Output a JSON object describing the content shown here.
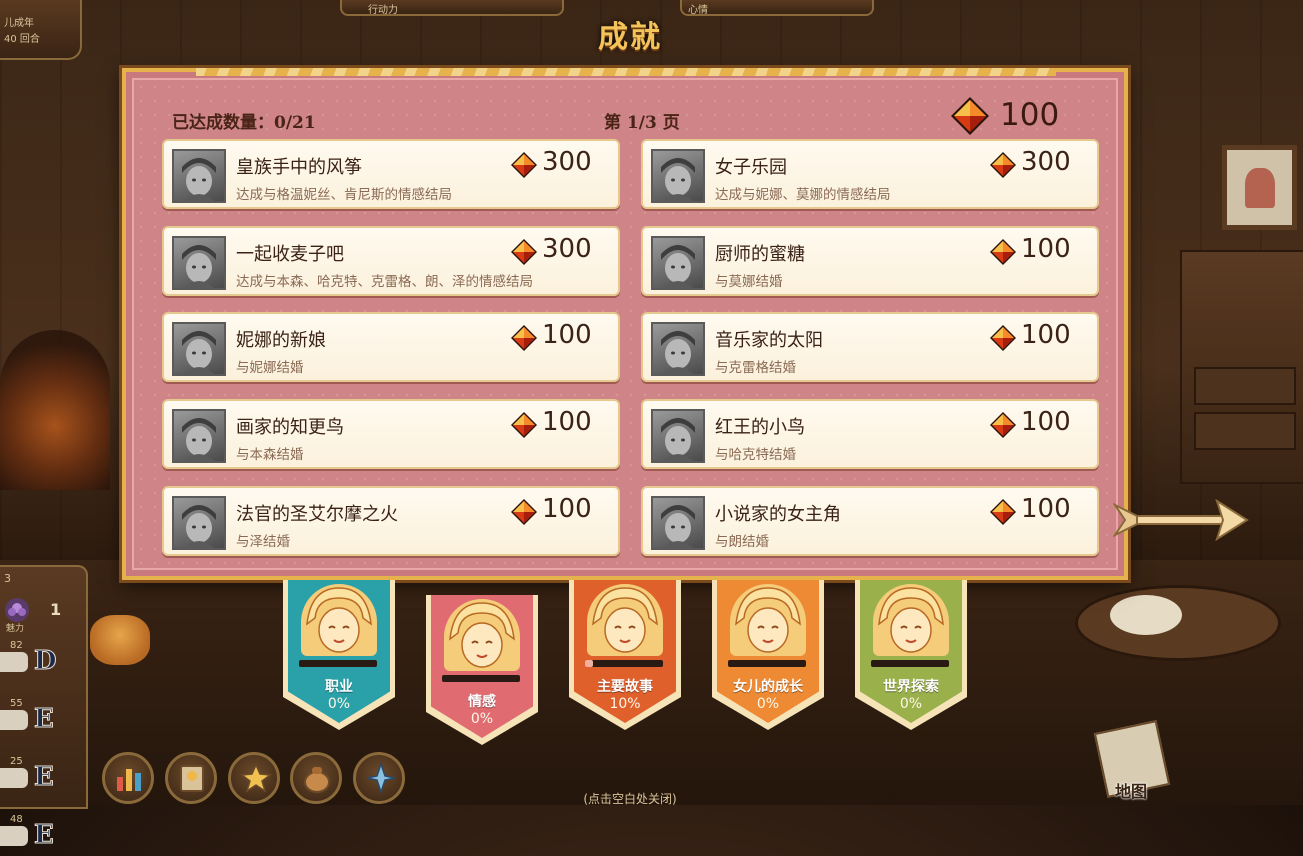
{
  "hud": {
    "left_line1": "儿成年",
    "left_line2": "40 回合",
    "action_label": "行动力",
    "mood_label": "心情"
  },
  "title": "成就",
  "header": {
    "achieved_label": "已达成数量：0/21",
    "page_label": "第 1/3 页",
    "points": "100"
  },
  "achievements": [
    {
      "name": "皇族手中的风筝",
      "desc": "达成与格温妮丝、肯尼斯的情感结局",
      "reward": "300"
    },
    {
      "name": "女子乐园",
      "desc": "达成与妮娜、莫娜的情感结局",
      "reward": "300"
    },
    {
      "name": "一起收麦子吧",
      "desc": "达成与本森、哈克特、克雷格、朗、泽的情感结局",
      "reward": "300"
    },
    {
      "name": "厨师的蜜糖",
      "desc": "与莫娜结婚",
      "reward": "100"
    },
    {
      "name": "妮娜的新娘",
      "desc": "与妮娜结婚",
      "reward": "100"
    },
    {
      "name": "音乐家的太阳",
      "desc": "与克雷格结婚",
      "reward": "100"
    },
    {
      "name": "画家的知更鸟",
      "desc": "与本森结婚",
      "reward": "100"
    },
    {
      "name": "红王的小鸟",
      "desc": "与哈克特结婚",
      "reward": "100"
    },
    {
      "name": "法官的圣艾尔摩之火",
      "desc": "与泽结婚",
      "reward": "100"
    },
    {
      "name": "小说家的女主角",
      "desc": "与朗结婚",
      "reward": "100"
    }
  ],
  "categories": [
    {
      "label": "职业",
      "pct": "0%",
      "progress": 0,
      "color": "#2aa0a8"
    },
    {
      "label": "情感",
      "pct": "0%",
      "progress": 0,
      "color": "#e06c72"
    },
    {
      "label": "主要故事",
      "pct": "10%",
      "progress": 0.1,
      "color": "#e0602c"
    },
    {
      "label": "女儿的成长",
      "pct": "0%",
      "progress": 0,
      "color": "#ee8a34"
    },
    {
      "label": "世界探索",
      "pct": "0%",
      "progress": 0,
      "color": "#9ab04a"
    }
  ],
  "stats": {
    "top": "3",
    "charm_label": "魅力",
    "charm_value": "1",
    "rows": [
      {
        "num": "82",
        "grade": "D"
      },
      {
        "num": "55",
        "grade": "E"
      },
      {
        "num": "25",
        "grade": "E"
      },
      {
        "num": "48",
        "grade": "E"
      }
    ]
  },
  "bottom_buttons": [
    "chart-icon",
    "diary-icon",
    "stars-icon",
    "bag-icon",
    "crest-icon"
  ],
  "hint": "(点击空白处关闭)",
  "map_label": "地图",
  "colors": {
    "title": "#f4c45a",
    "panel": "#cf8587",
    "gold_border": "#e6b24c",
    "gem_red": "#d83a14"
  }
}
